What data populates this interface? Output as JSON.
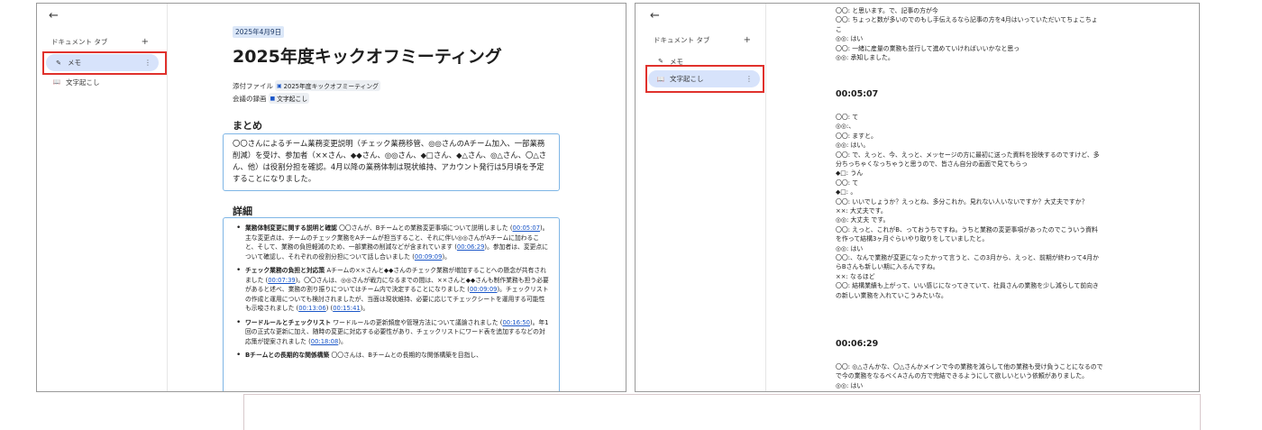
{
  "left": {
    "sidebar": {
      "tabs_header": "ドキュメント タブ",
      "add_icon": "+",
      "items": [
        {
          "label": "メモ",
          "icon": "memo-icon",
          "glyph": "✎",
          "active": true
        },
        {
          "label": "文字起こし",
          "icon": "book-icon",
          "glyph": "📖",
          "active": false
        }
      ]
    },
    "document": {
      "date": "2025年4月9日",
      "title": "2025年度キックオフミーティング",
      "attachment_label": "添付ファイル",
      "attachment_chip": "2025年度キックオフミーティング",
      "recording_label": "会議の録画",
      "recording_chip": "文字起こし",
      "summary_heading": "まとめ",
      "summary_text": "〇〇さんによるチーム業務変更説明（チェック業務移管、◎◎さんのAチーム加入、一部業務削減）を受け、参加者（××さん、◆◆さん、◎◎さん、◆□さん、◆△さん、◎△さん、〇△さん、他）は役割分担を確認。4月以降の業務体制は現状維持、アカウント発行は5月頃を予定することになりました。",
      "details_heading": "詳細",
      "details": [
        {
          "title": "業務体制変更に関する説明と確認",
          "parts": [
            {
              "t": " 〇〇さんが、Bチームとの業務変更事項について説明しました ("
            },
            {
              "ts": "00:05:07"
            },
            {
              "t": ")。主な変更点は、チームのチェック業務をAチームが担当すること、それに伴い◎◎さんがAチームに加わること、そして、業務の負担軽減のため、一部業務の削減などが含まれています ("
            },
            {
              "ts": "00:06:29"
            },
            {
              "t": ")。参加者は、変更点について確認し、それぞれの役割分担について話し合いました ("
            },
            {
              "ts": "00:09:09"
            },
            {
              "t": ")。"
            }
          ]
        },
        {
          "title": "チェック業務の負担と対応策",
          "parts": [
            {
              "t": " Aチームの××さんと◆◆さんのチェック業務が増加することへの懸念が共有されました ("
            },
            {
              "ts": "00:07:39"
            },
            {
              "t": ")。〇〇さんは、◎◎さんが戦力になるまでの間は、××さんと◆◆さんも制作業務も担う必要があると述べ、業務の割り振りについてはチーム内で決定することになりました ("
            },
            {
              "ts": "00:09:09"
            },
            {
              "t": ")。チェックリストの作成と運用についても検討されましたが、当面は現状維持、必要に応じてチェックシートを運用する可能性も示唆されました ("
            },
            {
              "ts": "00:13:06"
            },
            {
              "t": ") ("
            },
            {
              "ts": "00:15:41"
            },
            {
              "t": ")。"
            }
          ]
        },
        {
          "title": "ワードルールとチェックリスト",
          "parts": [
            {
              "t": " ワードルールの更新頻度や管理方法について議論されました ("
            },
            {
              "ts": "00:16:50"
            },
            {
              "t": ")。年1回の正式な更新に加え、随時の変更に対応する必要性があり、チェックリストにワード表を追加するなどの対応策が提案されました ("
            },
            {
              "ts": "00:18:08"
            },
            {
              "t": ")。"
            }
          ]
        },
        {
          "title": "Bチームとの長期的な関係構築",
          "parts": [
            {
              "t": " 〇〇さんは、Bチームとの長期的な関係構築を目指し、"
            }
          ]
        }
      ]
    }
  },
  "right": {
    "sidebar": {
      "tabs_header": "ドキュメント タブ",
      "add_icon": "+",
      "items": [
        {
          "label": "メモ",
          "icon": "memo-icon",
          "glyph": "✎",
          "active": false
        },
        {
          "label": "文字起こし",
          "icon": "book-icon",
          "glyph": "📖",
          "active": true
        }
      ]
    },
    "transcript": {
      "top_lines": [
        "〇〇: と思います。で、記事の方が今",
        "〇〇: ちょっと数が多いのでのもし手伝えるなら記事の方を4月はいっていただいてちょこちょ",
        "こ",
        "◎◎: はい",
        "〇〇: 一緒に産量の業務も並行して進めていければいいかなと思っ",
        "◎◎: 承知しました。"
      ],
      "time1": "00:05:07",
      "mid_lines": [
        "〇〇: て",
        "◎◎:、",
        "〇〇: ますと。",
        "◎◎: はい。",
        "〇〇: で、えっと、今、えっと、メッセージの方に最初に送った資料を投映するのですけど、多",
        "分ちっちゃくなっちゃうと思うので、皆さん自分の画面で見てもらっ",
        "◆□: うん",
        "〇〇: て",
        "◆□: 。",
        "〇〇: いいでしょうか？えっとね、多分これか。見れない人いないですか？大丈夫ですか？",
        "××: 大丈夫です。",
        "◎◎: 大丈夫 です。",
        "〇〇: えっと、これがB、っておうちですね。うちと業務の変更事項があったのでこういう資料",
        "を作って結構3ヶ月ぐらいやり取りをしていましたと。",
        "◎◎: はい",
        "〇〇:、なんで業務が変更になったかって言うと、この3月から、えっと、前期が終わって4月か",
        "らBさんも新しい期に入るんですね。",
        "××: なるほど",
        "〇〇: 結構業績も上がって、いい感じになってきていて、社員さんの業務を少し減らして前向き",
        "の新しい業務を入れていこうみたいな。"
      ],
      "time2": "00:06:29",
      "bottom_lines": [
        "〇〇: ◎△さんかな、〇△さんかメインで今の業務を減らして他の業務も受け負うことになるので",
        "で今の業務をなるべくAさんの方で完結できるようにして欲しいという依頼がありました。",
        "◎◎: はい"
      ]
    }
  }
}
